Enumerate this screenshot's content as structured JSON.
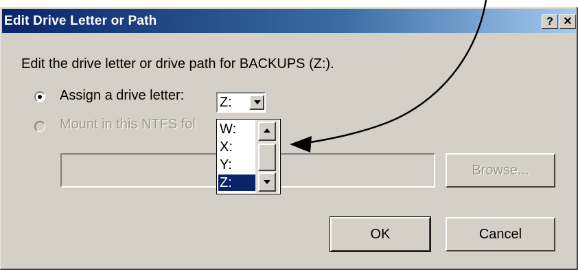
{
  "dialog": {
    "title": "Edit Drive Letter or Path",
    "help_label": "?",
    "close_label": "✕",
    "description": "Edit the drive letter or drive path for BACKUPS (Z:)."
  },
  "options": {
    "assign_letter_label": "Assign a drive letter:",
    "assign_letter_selected": true,
    "mount_label": "Mount in this NTFS fol",
    "mount_selected": false,
    "mount_enabled": false
  },
  "drive_combo": {
    "selected_value": "Z:",
    "visible_options": [
      "W:",
      "X:",
      "Y:",
      "Z:"
    ],
    "highlighted_option": "Z:"
  },
  "path_input": {
    "value": ""
  },
  "buttons": {
    "browse_label": "Browse...",
    "ok_label": "OK",
    "cancel_label": "Cancel"
  },
  "colors": {
    "titlebar_start": "#0a246a",
    "titlebar_end": "#a6caf0",
    "dialog_face": "#d4d0c8",
    "selection": "#0a246a",
    "arrow": "#000000"
  }
}
